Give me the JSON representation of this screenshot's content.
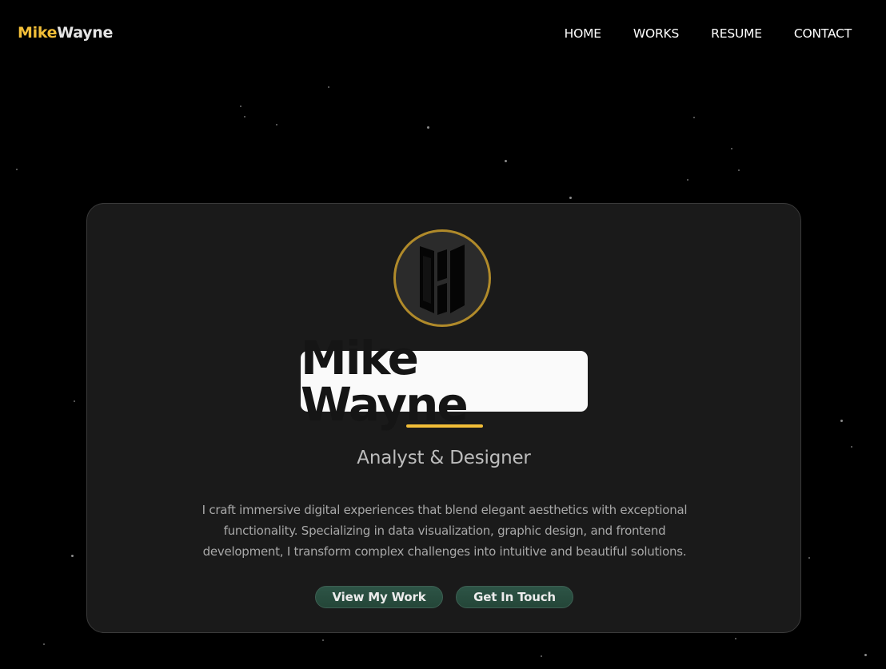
{
  "brand": {
    "first": "Mike",
    "last": "Wayne",
    "accent_color": "#f2be38"
  },
  "nav": {
    "items": [
      {
        "label": "HOME"
      },
      {
        "label": "WORKS"
      },
      {
        "label": "RESUME"
      },
      {
        "label": "CONTACT"
      }
    ]
  },
  "hero": {
    "avatar_icon": "mw-monogram-icon",
    "name": "Mike Wayne",
    "role": "Analyst & Designer",
    "bio": "I craft immersive digital experiences that blend elegant aesthetics with exceptional functionality. Specializing in data visualization, graphic design, and frontend development, I transform complex challenges into intuitive and beautiful solutions.",
    "buttons": {
      "primary_label": "View My Work",
      "secondary_label": "Get In Touch",
      "color": "#2d5446"
    }
  }
}
